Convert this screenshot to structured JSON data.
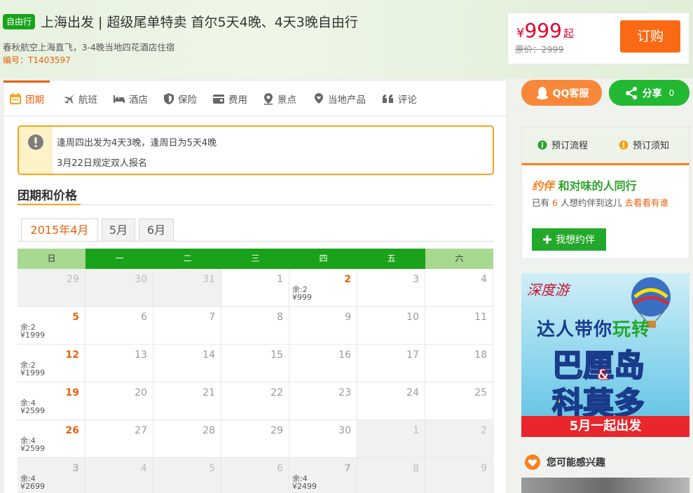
{
  "product": {
    "badge": "自由行",
    "title": "上海出发 | 超级尾单特卖 首尔5天4晚、4天3晚自由行",
    "subtitle": "春秋航空上海直飞，3-4晚当地四花酒店住宿",
    "code": "编号：T1403597"
  },
  "price": {
    "currency": "¥",
    "value": "999",
    "suffix": "起",
    "original": "原价：2999",
    "order_label": "订购"
  },
  "tabs": [
    {
      "label": "团期",
      "icon": "calendar-icon",
      "active": true
    },
    {
      "label": "航班",
      "icon": "airplane-icon"
    },
    {
      "label": "酒店",
      "icon": "bed-icon"
    },
    {
      "label": "保险",
      "icon": "shield-icon"
    },
    {
      "label": "费用",
      "icon": "wallet-icon"
    },
    {
      "label": "景点",
      "icon": "map-pin-icon"
    },
    {
      "label": "当地产品",
      "icon": "location-heart-icon"
    },
    {
      "label": "评论",
      "icon": "quote-icon"
    }
  ],
  "notice": {
    "line1": "逢周四出发为4天3晚，逢周日为5天4晚",
    "line2": "3月22日规定双人报名"
  },
  "schedule": {
    "section_title": "团期和价格",
    "months": [
      "2015年4月",
      "5月",
      "6月"
    ],
    "weekdays": [
      "日",
      "一",
      "二",
      "三",
      "四",
      "五",
      "六"
    ],
    "weeks": [
      [
        {
          "d": "29",
          "o": true
        },
        {
          "d": "30",
          "o": true
        },
        {
          "d": "31",
          "o": true
        },
        {
          "d": "1"
        },
        {
          "d": "2",
          "s": "余:2",
          "p": "¥999"
        },
        {
          "d": "3"
        },
        {
          "d": "4"
        }
      ],
      [
        {
          "d": "5",
          "s": "余:2",
          "p": "¥1999"
        },
        {
          "d": "6"
        },
        {
          "d": "7"
        },
        {
          "d": "8"
        },
        {
          "d": "9"
        },
        {
          "d": "10"
        },
        {
          "d": "11"
        }
      ],
      [
        {
          "d": "12",
          "s": "余:2",
          "p": "¥1999"
        },
        {
          "d": "13"
        },
        {
          "d": "14"
        },
        {
          "d": "15"
        },
        {
          "d": "16"
        },
        {
          "d": "17"
        },
        {
          "d": "18"
        }
      ],
      [
        {
          "d": "19",
          "s": "余:4",
          "p": "¥2599"
        },
        {
          "d": "20"
        },
        {
          "d": "21"
        },
        {
          "d": "22"
        },
        {
          "d": "23"
        },
        {
          "d": "24"
        },
        {
          "d": "25"
        }
      ],
      [
        {
          "d": "26",
          "s": "余:4",
          "p": "¥2599"
        },
        {
          "d": "27"
        },
        {
          "d": "28"
        },
        {
          "d": "29"
        },
        {
          "d": "30"
        },
        {
          "d": "1",
          "o": true
        },
        {
          "d": "2",
          "o": true
        }
      ],
      [
        {
          "d": "3",
          "o": true,
          "s": "余:4",
          "p": "¥2699"
        },
        {
          "d": "4",
          "o": true
        },
        {
          "d": "5",
          "o": true
        },
        {
          "d": "6",
          "o": true
        },
        {
          "d": "7",
          "o": true,
          "s": "余:4",
          "p": "¥2499"
        },
        {
          "d": "8",
          "o": true
        },
        {
          "d": "9",
          "o": true
        }
      ]
    ]
  },
  "sidebar": {
    "qq_label": "QQ客服",
    "share_label": "分享",
    "share_count": "0",
    "booking_flow": "预订流程",
    "booking_notes": "预订须知",
    "companion": {
      "logo": "约伴",
      "title": "和对味的人同行",
      "text_pre": "已有",
      "count": "6",
      "text_mid": "人想约伴到这儿",
      "link": "去看看有谁",
      "button": "我想约伴"
    },
    "banner": {
      "brand": "深度游",
      "tagline_a": "达人带你",
      "tagline_b": "玩转",
      "dest1": "巴厘岛",
      "amp": "&",
      "dest2": "科莫多",
      "footer": "5月一起出发"
    },
    "interest": "您可能感兴趣"
  },
  "colors": {
    "accent": "#e8620c",
    "green": "#1aa31a",
    "price_red": "#e4002b",
    "order_orange": "#fa6a14"
  }
}
